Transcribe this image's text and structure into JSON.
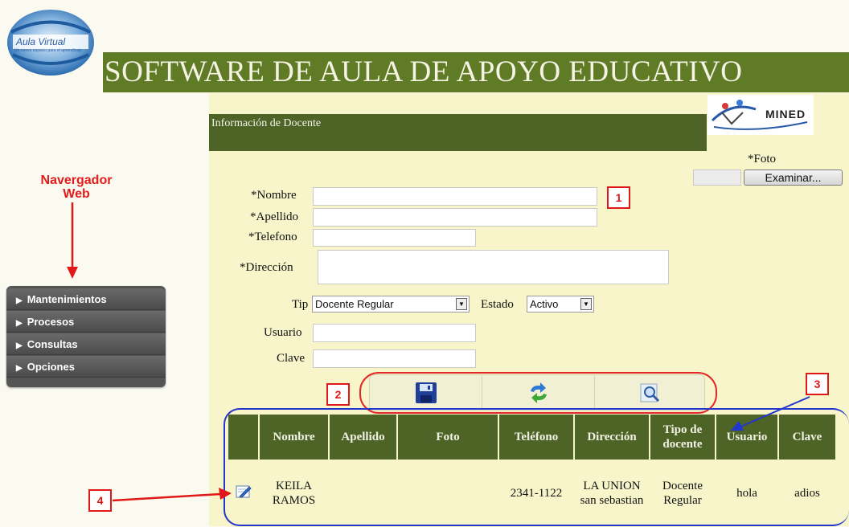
{
  "header": {
    "logo_text": "Aula Virtual",
    "logo_subtext": "Un nuevo espacio para el aprendizaje",
    "title": "SOFTWARE DE AULA DE APOYO EDUCATIVO"
  },
  "panel": {
    "title": "Información de Docente",
    "mined_logo": "MINED"
  },
  "annotations": {
    "browser_label_line1": "Navergador",
    "browser_label_line2": "Web",
    "callout_1": "1",
    "callout_2": "2",
    "callout_3": "3",
    "callout_4": "4"
  },
  "sidebar": {
    "items": [
      {
        "label": "Mantenimientos"
      },
      {
        "label": "Procesos"
      },
      {
        "label": "Consultas"
      },
      {
        "label": "Opciones"
      }
    ]
  },
  "form": {
    "foto_label": "*Foto",
    "browse_button": "Examinar...",
    "nombre_label": "*Nombre",
    "apellido_label": "*Apellido",
    "telefono_label": "*Telefono",
    "direccion_label": "*Dirección",
    "tipo_label": "Tip",
    "tipo_value": "Docente Regular",
    "estado_label": "Estado",
    "estado_value": "Activo",
    "usuario_label": "Usuario",
    "clave_label": "Clave"
  },
  "toolbar": {
    "buttons": [
      {
        "icon": "save-icon"
      },
      {
        "icon": "refresh-icon"
      },
      {
        "icon": "search-icon"
      }
    ]
  },
  "table": {
    "columns": [
      "",
      "Nombre",
      "Apellido",
      "Foto",
      "Teléfono",
      "Dirección",
      "Tipo de docente",
      "Usuario",
      "Clave"
    ],
    "rows": [
      {
        "edit_icon": "edit-icon",
        "nombre": "KEILA RAMOS",
        "apellido": "",
        "foto": "",
        "telefono": "2341-1122",
        "direccion": "LA UNION san sebastian",
        "tipo": "Docente Regular",
        "usuario": "hola",
        "clave": "adios"
      }
    ]
  },
  "colors": {
    "header_green": "#5f7b25",
    "panel_green": "#4e6427",
    "cream": "#f7f5c9",
    "annotation_red": "#e01818",
    "annotation_blue": "#2336cf"
  }
}
